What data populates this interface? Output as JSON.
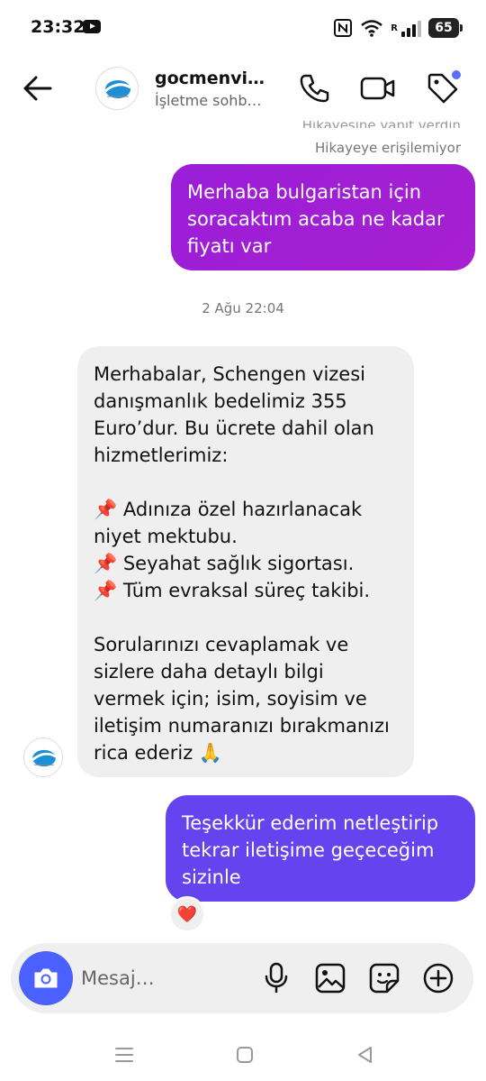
{
  "status_bar": {
    "time": "23:32",
    "signal_label": "R",
    "battery": "65",
    "icons": [
      "youtube-icon",
      "nfc-icon",
      "wifi-icon",
      "signal-icon",
      "battery-icon"
    ]
  },
  "header": {
    "name": "gocmenvi…",
    "subtitle": "İşletme sohb…",
    "icons": [
      "back-arrow-icon",
      "phone-icon",
      "video-camera-icon",
      "tag-icon"
    ],
    "accent_dot_color": "#5b6cff"
  },
  "chat": {
    "reply_partial": "Hikayesine yanıt verdin",
    "story_note": "Hikayeye erişilemiyor",
    "messages": [
      {
        "direction": "outgoing",
        "text": "Merhaba bulgaristan için soracaktım acaba ne kadar fiyatı var",
        "color": "#a020d6"
      },
      {
        "direction": "incoming",
        "text": "Merhabalar, Schengen vizesi danışmanlık bedelimiz 355 Euro’dur. Bu ücrete dahil olan hizmetlerimiz:\n\n📌 Adınıza özel hazırlanacak niyet mektubu.\n📌 Seyahat sağlık sigortası.\n📌 Tüm evraksal süreç takibi.\n\nSorularınızı cevaplamak ve sizlere daha detaylı bilgi vermek için; isim, soyisim ve iletişim numaranızı bırakmanızı rica ederiz 🙏",
        "color": "#efefef"
      },
      {
        "direction": "outgoing",
        "text": "Teşekkür ederim netleştirip tekrar iletişime geçeceğim sizinle",
        "color": "#6544f0",
        "reaction": "❤️"
      }
    ],
    "timestamp": "2 Ağu 22:04"
  },
  "composer": {
    "placeholder": "Mesaj…",
    "camera_color": "#4a61ff",
    "icons": [
      "camera-icon",
      "microphone-icon",
      "gallery-icon",
      "sticker-icon",
      "plus-icon"
    ]
  },
  "nav_bar": {
    "icons": [
      "recent-apps-icon",
      "home-icon",
      "back-triangle-icon"
    ]
  }
}
